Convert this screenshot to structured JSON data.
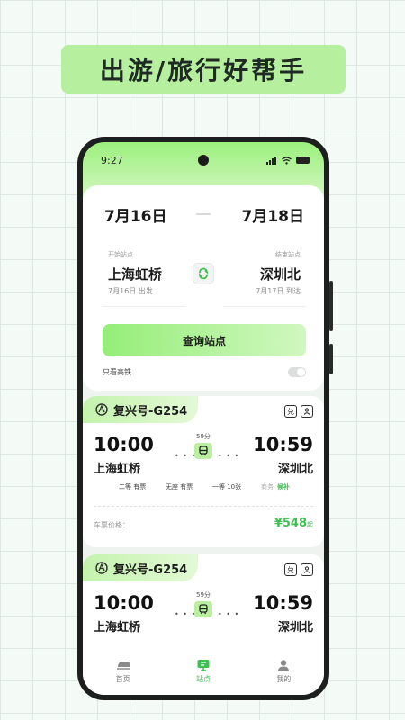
{
  "banner": {
    "title": "出游/旅行好帮手"
  },
  "status": {
    "time": "9:27"
  },
  "search": {
    "date_from": "7月16日",
    "date_to": "7月18日",
    "start_label": "开始站点",
    "end_label": "结束站点",
    "start_station": "上海虹桥",
    "end_station": "深圳北",
    "start_note": "7月16日 出发",
    "end_note": "7月17日 到达",
    "button_label": "查询站点",
    "hsr_only_label": "只看高铁",
    "hsr_only_enabled": false
  },
  "trains": [
    {
      "name": "复兴号-G254",
      "badge_exchange": "兑",
      "dep_time": "10:00",
      "arr_time": "10:59",
      "dep_station": "上海虹桥",
      "arr_station": "深圳北",
      "duration": "59分",
      "seats": [
        "二等 有票",
        "无座 有票",
        "一等 10张",
        "商务"
      ],
      "seat_status_extra": "候补",
      "price_label": "车票价格：",
      "price": "¥548",
      "price_suffix": "起"
    },
    {
      "name": "复兴号-G254",
      "badge_exchange": "兑",
      "dep_time": "10:00",
      "arr_time": "10:59",
      "dep_station": "上海虹桥",
      "arr_station": "深圳北",
      "duration": "59分"
    }
  ],
  "nav": {
    "items": [
      {
        "label": "首页"
      },
      {
        "label": "站点"
      },
      {
        "label": "我的"
      }
    ]
  },
  "colors": {
    "accent": "#3ec152",
    "banner": "#b6ef9e",
    "tag": "#c4f3ad"
  }
}
